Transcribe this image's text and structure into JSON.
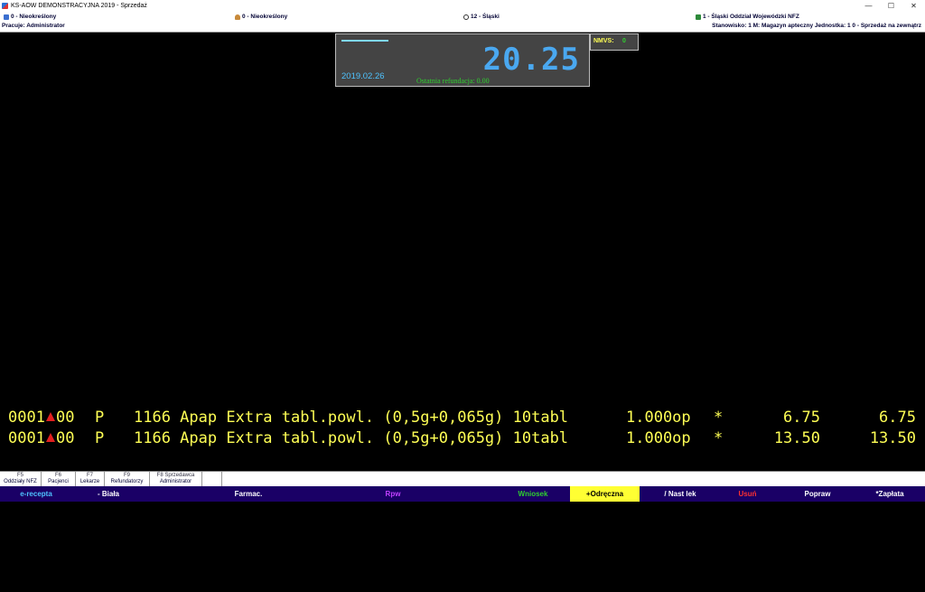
{
  "window": {
    "title": "KS-AOW DEMONSTRACYJNA 2019 - Sprzedaż",
    "minimize": "—",
    "maximize": "☐",
    "close": "✕"
  },
  "info": {
    "left_item": "0 - Nieokreślony",
    "doctor_item": "0 - Nieokreślony",
    "region_item": "12 - Śląski",
    "nfz_item": "1 - Śląski Oddział Wojewódzki NFZ",
    "operator": "Pracuje: Administrator",
    "station": "Stanowisko: 1  M: Magazyn apteczny  Jednostka: 1  0 - Sprzedaż na zewnątrz"
  },
  "display": {
    "amount": "20.25",
    "date": "2019.02.26",
    "last_refund": "Ostatnia refundacja: 0.00",
    "accent_color": "#4aa8f0"
  },
  "nmvs": {
    "label": "NMVS:",
    "value": "0"
  },
  "lines": [
    {
      "code_a": "0001",
      "code_b": "00",
      "type": "P",
      "item": "1166 Apap Extra tabl.powl. (0,5g+0,065g) 10tabl",
      "qty": "1.000op",
      "star": "*",
      "price": "6.75",
      "total": "6.75"
    },
    {
      "code_a": "0001",
      "code_b": "00",
      "type": "P",
      "item": "1166 Apap Extra tabl.powl. (0,5g+0,065g) 10tabl",
      "qty": "1.000op",
      "star": "*",
      "price": "13.50",
      "total": "13.50"
    }
  ],
  "fkeys": [
    {
      "key": "F5",
      "label": "Oddziały NFZ"
    },
    {
      "key": "F6",
      "label": "Pacjenci"
    },
    {
      "key": "F7",
      "label": "Lekarze"
    },
    {
      "key": "F9",
      "label": "Refundatorzy"
    },
    {
      "key": "F8 Sprzedawca",
      "label": "Administrator"
    }
  ],
  "modes": [
    {
      "label": "e-recepta",
      "color": "#4ec3ff"
    },
    {
      "label": "- Biała",
      "color": "#ffffff"
    },
    {
      "label": "Farmac.",
      "color": "#ffffff"
    },
    {
      "label": "Rpw",
      "color": "#c040ff"
    },
    {
      "label": "Wniosek",
      "color": "#2fd02f"
    },
    {
      "label": "+Odręczna",
      "color": "#000000"
    },
    {
      "label": "/ Nast lek",
      "color": "#ffffff"
    },
    {
      "label": "Usuń",
      "color": "#ff3030"
    },
    {
      "label": "Popraw",
      "color": "#ffffff"
    },
    {
      "label": "*Zapłata",
      "color": "#ffffff"
    }
  ]
}
